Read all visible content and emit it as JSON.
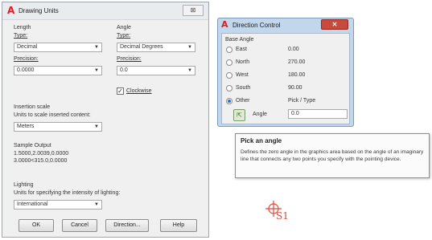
{
  "drawing_units": {
    "title": "Drawing Units",
    "close": "⊠",
    "length": {
      "heading": "Length",
      "type_label": "Type:",
      "type_value": "Decimal",
      "precision_label": "Precision:",
      "precision_value": "0.0000"
    },
    "angle": {
      "heading": "Angle",
      "type_label": "Type:",
      "type_value": "Decimal Degrees",
      "precision_label": "Precision:",
      "precision_value": "0.0",
      "clockwise_label": "Clockwise",
      "clockwise_checked": true
    },
    "insertion": {
      "heading": "Insertion scale",
      "sub": "Units to scale inserted content:",
      "value": "Meters"
    },
    "sample": {
      "heading": "Sample Output",
      "line1": "1.5000,2.0039,0.0000",
      "line2": "3.0000<315.0,0.0000"
    },
    "lighting": {
      "heading": "Lighting",
      "sub": "Units for specifying the intensity of lighting:",
      "value": "International"
    },
    "buttons": {
      "ok": "OK",
      "cancel": "Cancel",
      "direction": "Direction...",
      "help": "Help"
    }
  },
  "direction_control": {
    "title": "Direction Control",
    "close": "✕",
    "base_angle": "Base Angle",
    "options": [
      {
        "label": "East",
        "value": "0.00",
        "selected": false
      },
      {
        "label": "North",
        "value": "270.00",
        "selected": false
      },
      {
        "label": "West",
        "value": "180.00",
        "selected": false
      },
      {
        "label": "South",
        "value": "90.00",
        "selected": false
      },
      {
        "label": "Other",
        "value": "Pick / Type",
        "selected": true
      }
    ],
    "angle_label": "Angle",
    "angle_value": "0.0"
  },
  "tooltip": {
    "title": "Pick an angle",
    "body": "Defines the zero angle in the graphics area based on the angle of an imaginary line that connects any two points you specify with the pointing device."
  },
  "drawing": {
    "point_label": "S1",
    "marker_color": "#e04a3a"
  }
}
